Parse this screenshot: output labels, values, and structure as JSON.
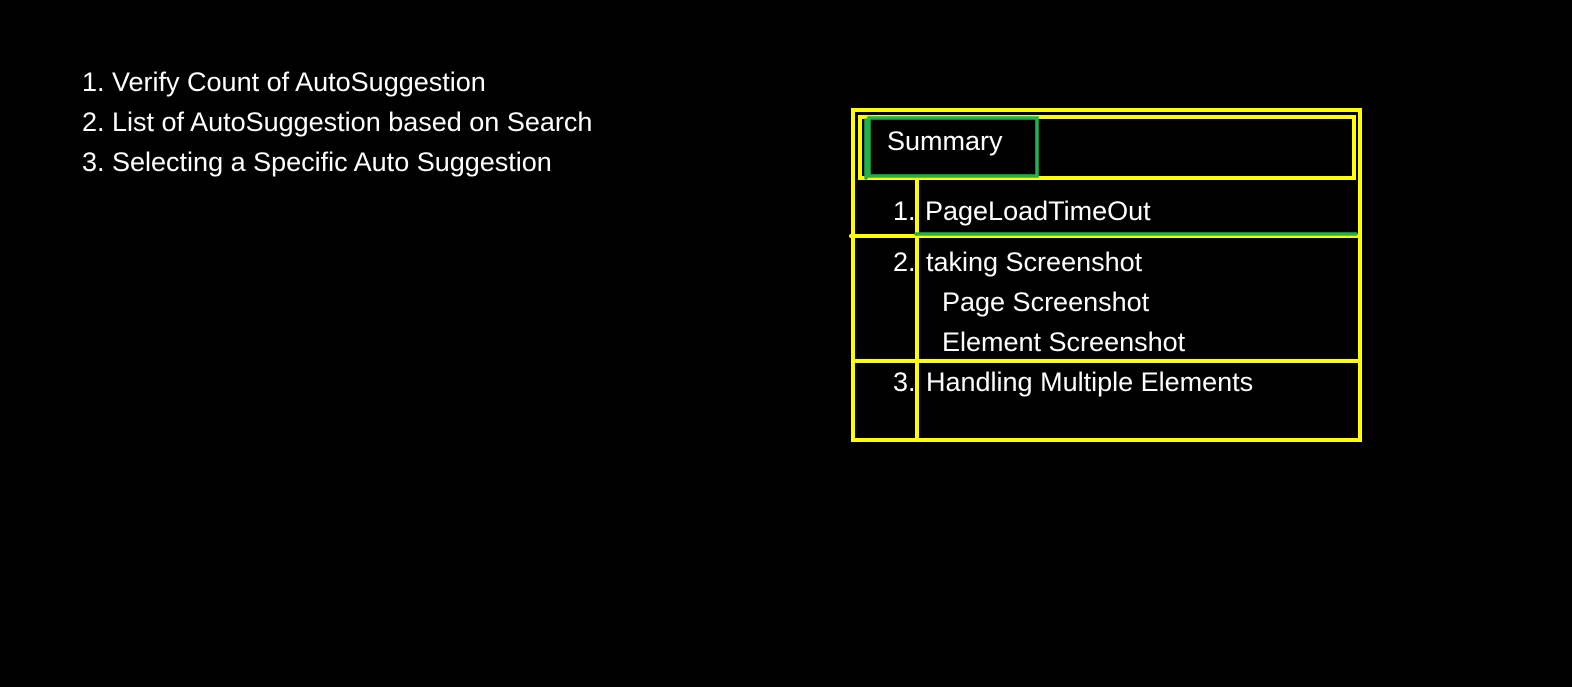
{
  "agenda": {
    "items": [
      "1. Verify Count of AutoSuggestion",
      "2. List of AutoSuggestion based on Search",
      "3. Selecting a Specific Auto Suggestion"
    ]
  },
  "summary_box": {
    "title": "Summary",
    "items": [
      {
        "number": "1.",
        "text": "PageLoadTimeOut",
        "subitems": []
      },
      {
        "number": "2.",
        "text": "taking Screenshot",
        "subitems": [
          "Page Screenshot",
          "Element Screenshot"
        ]
      },
      {
        "number": "3.",
        "text": "Handling Multiple Elements",
        "subitems": []
      }
    ]
  },
  "colors": {
    "background": "#000000",
    "text": "#ffffff",
    "highlight_yellow": "#ffff00",
    "highlight_green": "#22b14c"
  }
}
